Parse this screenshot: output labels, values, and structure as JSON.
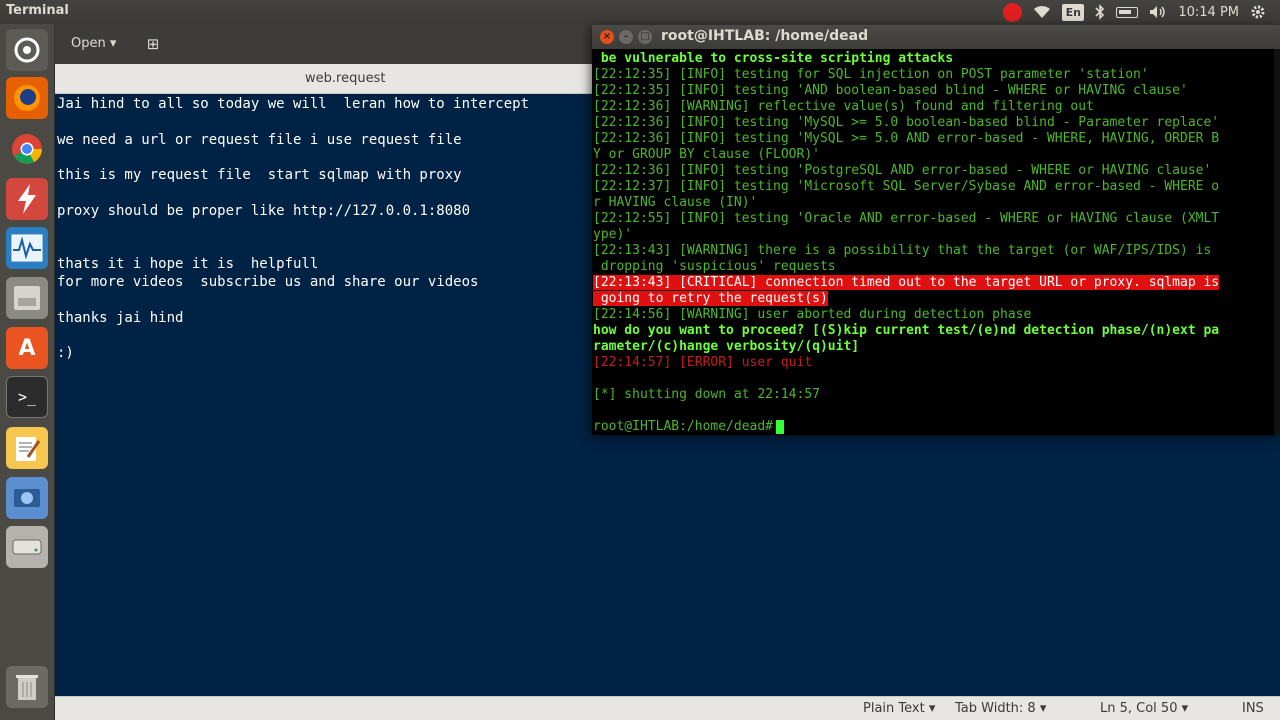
{
  "topbar": {
    "app_title": "Terminal",
    "lang": "En",
    "clock": "10:14 PM"
  },
  "launcher": {
    "items": [
      "dash-icon",
      "firefox-icon",
      "chrome-icon",
      "lightning-icon",
      "system-monitor-icon",
      "files-icon",
      "software-center-icon",
      "terminal-icon",
      "text-editor-icon",
      "screenshot-icon",
      "drive-icon",
      "trash-icon"
    ]
  },
  "editor": {
    "open_label": "Open",
    "doc_title": "web.request",
    "text": "Jai hind to all so today we will  leran how to intercept\n\nwe need a url or request file i use request file\n\nthis is my request file  start sqlmap with proxy\n\nproxy should be proper like http://127.0.0.1:8080\n\n\nthats it i hope it is  helpfull\nfor more videos  subscribe us and share our videos\n\nthanks jai hind\n\n:)",
    "status": {
      "mode": "Plain Text",
      "tab_width": "Tab Width: 8",
      "position": "Ln 5, Col 50",
      "ins": "INS"
    }
  },
  "terminal": {
    "title": "root@IHTLAB: /home/dead",
    "lines": [
      {
        "t": " be vulnerable to cross-site scripting attacks",
        "c": "c-bold"
      },
      {
        "t": "[22:12:35] [INFO] testing for SQL injection on POST parameter 'station'",
        "c": "c-info"
      },
      {
        "t": "[22:12:35] [INFO] testing 'AND boolean-based blind - WHERE or HAVING clause'",
        "c": "c-info"
      },
      {
        "t": "[22:12:36] [WARNING] reflective value(s) found and filtering out",
        "c": "c-info"
      },
      {
        "t": "[22:12:36] [INFO] testing 'MySQL >= 5.0 boolean-based blind - Parameter replace'",
        "c": "c-info"
      },
      {
        "t": "[22:12:36] [INFO] testing 'MySQL >= 5.0 AND error-based - WHERE, HAVING, ORDER B",
        "c": "c-info"
      },
      {
        "t": "Y or GROUP BY clause (FLOOR)'",
        "c": "c-info"
      },
      {
        "t": "[22:12:36] [INFO] testing 'PostgreSQL AND error-based - WHERE or HAVING clause'",
        "c": "c-info"
      },
      {
        "t": "[22:12:37] [INFO] testing 'Microsoft SQL Server/Sybase AND error-based - WHERE o",
        "c": "c-info"
      },
      {
        "t": "r HAVING clause (IN)'",
        "c": "c-info"
      },
      {
        "t": "[22:12:55] [INFO] testing 'Oracle AND error-based - WHERE or HAVING clause (XMLT",
        "c": "c-info"
      },
      {
        "t": "ype)'",
        "c": "c-info"
      },
      {
        "t": "[22:13:43] [WARNING] there is a possibility that the target (or WAF/IPS/IDS) is",
        "c": "c-info"
      },
      {
        "t": " dropping 'suspicious' requests",
        "c": "c-info"
      },
      {
        "t": "[22:13:43] [CRITICAL] connection timed out to the target URL or proxy. sqlmap is",
        "c": "c-crit"
      },
      {
        "t": " going to retry the request(s)",
        "c": "c-crit"
      },
      {
        "t": "[22:14:56] [WARNING] user aborted during detection phase",
        "c": "c-info"
      },
      {
        "t": "how do you want to proceed? [(S)kip current test/(e)nd detection phase/(n)ext pa",
        "c": "c-bold"
      },
      {
        "t": "rameter/(c)hange verbosity/(q)uit]",
        "c": "c-bold"
      },
      {
        "t": "[22:14:57] [ERROR] user quit",
        "c": "c-err"
      },
      {
        "t": "",
        "c": "c-info"
      },
      {
        "t": "[*] shutting down at 22:14:57",
        "c": "c-info"
      },
      {
        "t": "",
        "c": "c-info"
      }
    ],
    "prompt": "root@IHTLAB:/home/dead#"
  }
}
